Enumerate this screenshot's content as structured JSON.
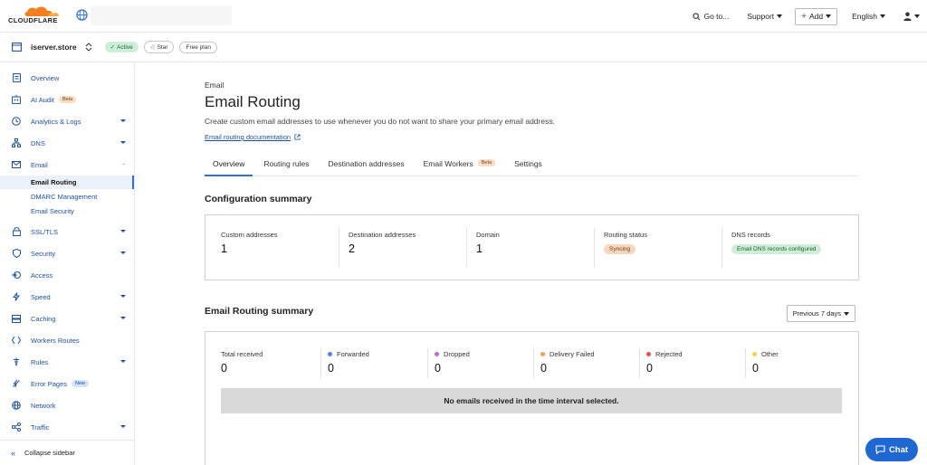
{
  "header": {
    "logo_text": "CLOUDFLARE",
    "goto_label": "Go to...",
    "support_label": "Support",
    "add_label": "Add",
    "language_label": "English"
  },
  "zone": {
    "name": "iserver.store",
    "status": "Active",
    "star_label": "Star",
    "plan": "Free plan"
  },
  "sidebar": {
    "items": [
      {
        "label": "Overview",
        "icon": "document-icon"
      },
      {
        "label": "AI Audit",
        "icon": "ai-audit-icon",
        "badge": "Beta"
      },
      {
        "label": "Analytics & Logs",
        "icon": "clock-icon"
      },
      {
        "label": "DNS",
        "icon": "network-icon"
      },
      {
        "label": "Email",
        "icon": "mail-icon"
      },
      {
        "label": "SSL/TLS",
        "icon": "lock-icon"
      },
      {
        "label": "Security",
        "icon": "shield-icon"
      },
      {
        "label": "Access",
        "icon": "access-icon"
      },
      {
        "label": "Speed",
        "icon": "bolt-icon"
      },
      {
        "label": "Caching",
        "icon": "server-icon"
      },
      {
        "label": "Workers Routes",
        "icon": "workers-icon"
      },
      {
        "label": "Rules",
        "icon": "rules-icon"
      },
      {
        "label": "Error Pages",
        "icon": "error-icon",
        "badge": "New"
      },
      {
        "label": "Network",
        "icon": "globe-icon"
      },
      {
        "label": "Traffic",
        "icon": "traffic-icon"
      }
    ],
    "email_sub": [
      "Email Routing",
      "DMARC Management",
      "Email Security"
    ],
    "collapse_label": "Collapse sidebar"
  },
  "main": {
    "breadcrumb": "Email",
    "title": "Email Routing",
    "description": "Create custom email addresses to use whenever you do not want to share your primary email address.",
    "doc_link": "Email routing documentation",
    "tabs": [
      {
        "label": "Overview"
      },
      {
        "label": "Routing rules"
      },
      {
        "label": "Destination addresses"
      },
      {
        "label": "Email Workers",
        "badge": "Beta"
      },
      {
        "label": "Settings"
      }
    ]
  },
  "config_summary": {
    "title": "Configuration summary",
    "custom_addresses_label": "Custom addresses",
    "custom_addresses_value": "1",
    "destination_addresses_label": "Destination addresses",
    "destination_addresses_value": "2",
    "domain_label": "Domain",
    "domain_value": "1",
    "routing_status_label": "Routing status",
    "routing_status_value": "Syncing",
    "dns_records_label": "DNS records",
    "dns_records_value": "Email DNS records configured"
  },
  "routing_summary": {
    "title": "Email Routing summary",
    "period": "Previous 7 days",
    "stats": [
      {
        "label": "Total received",
        "value": "0",
        "color": ""
      },
      {
        "label": "Forwarded",
        "value": "0",
        "color": "#4a86e8"
      },
      {
        "label": "Dropped",
        "value": "0",
        "color": "#b66bd9"
      },
      {
        "label": "Delivery Failed",
        "value": "0",
        "color": "#f2a14a"
      },
      {
        "label": "Rejected",
        "value": "0",
        "color": "#e8553f"
      },
      {
        "label": "Other",
        "value": "0",
        "color": "#f2d24a"
      }
    ],
    "empty_message": "No emails received in the time interval selected."
  },
  "chat": {
    "label": "Chat"
  }
}
